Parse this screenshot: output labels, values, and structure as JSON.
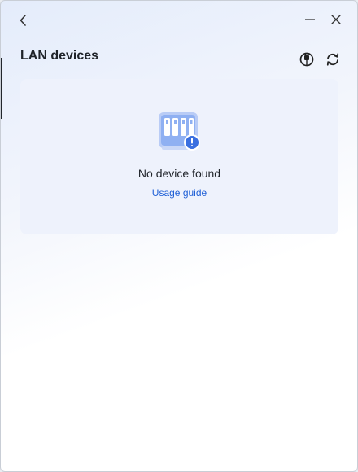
{
  "window": {
    "title": "LAN devices"
  },
  "titlebar": {
    "back_icon": "chevron-left-icon",
    "minimize_icon": "minimize-icon",
    "close_icon": "close-icon"
  },
  "toolbar": {
    "plug_icon": "plug-icon",
    "refresh_icon": "refresh-icon"
  },
  "empty_state": {
    "icon": "nas-device-warning-icon",
    "message": "No device found",
    "link": "Usage guide"
  },
  "colors": {
    "accent": "#1e5fd6",
    "card_bg": "#eef2fc",
    "illustration": "#7aa0f0"
  }
}
